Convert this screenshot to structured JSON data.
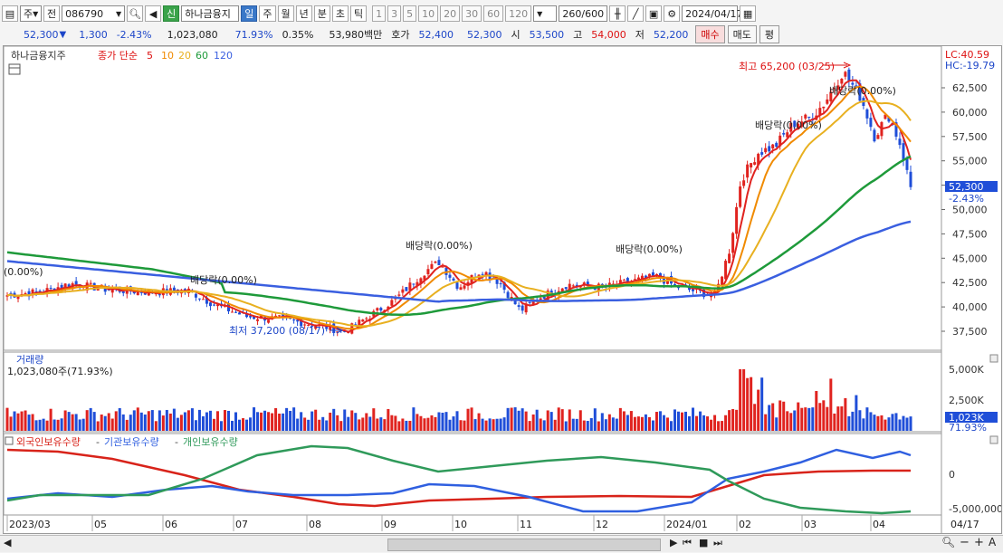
{
  "toolbar": {
    "kind_select": "주",
    "prev_btn": "전",
    "code": "086790",
    "new_badge": "신",
    "stock_name": "하나금융지",
    "periods": [
      "일",
      "주",
      "월",
      "년",
      "분",
      "초",
      "틱"
    ],
    "active_period": "일",
    "intervals": [
      "1",
      "3",
      "5",
      "10",
      "20",
      "30",
      "60",
      "120"
    ],
    "count": "260",
    "count_max": "/600",
    "date": "2024/04/17"
  },
  "quote": {
    "price": "52,300",
    "change": "1,300",
    "change_pct": "-2.43%",
    "volume": "1,023,080",
    "volume_ratio": "71.93%",
    "turnover_pct": "0.35%",
    "amount": "53,980백만",
    "bid_label": "호가",
    "ask": "52,400",
    "bid": "52,300",
    "open_label": "시",
    "open": "53,500",
    "high_label": "고",
    "high": "54,000",
    "low_label": "저",
    "low": "52,200",
    "buy_btn": "매수",
    "sell_btn": "매도",
    "eval_btn": "평"
  },
  "price_panel": {
    "name": "하나금융지주",
    "series_label": "종가 단순",
    "ma": [
      "5",
      "10",
      "20",
      "60",
      "120"
    ],
    "lc": "LC:40.59",
    "hc": "HC:-19.79",
    "high_note": "최고 65,200 (03/25)",
    "low_note": "최저 37,200 (08/17)",
    "dividend_notes": [
      "배당락(0.00%)",
      "배당락(0.00%)",
      "배당락(0.00%)",
      "배당락(0.00%)",
      "배당락(0.00%)",
      "(0.00%)"
    ],
    "yticks": [
      "62,500",
      "60,000",
      "57,500",
      "55,000",
      "52,500",
      "50,000",
      "47,500",
      "45,000",
      "42,500",
      "40,000",
      "37,500"
    ],
    "last_price_tag": "52,300",
    "last_change_tag": "-2.43%"
  },
  "volume_panel": {
    "title": "거래량",
    "info": "1,023,080주(71.93%)",
    "yticks": [
      "5,000K",
      "2,500K"
    ],
    "last_tag": "1,023K",
    "last_pct": "71.93%"
  },
  "holders_panel": {
    "legend": [
      "외국인보유수량",
      "기관보유수량",
      "개인보유수량"
    ],
    "yticks": [
      "0",
      "-5,000,000"
    ]
  },
  "xaxis": [
    "2023/03",
    "05",
    "06",
    "07",
    "08",
    "09",
    "10",
    "11",
    "12",
    "2024/01",
    "02",
    "03",
    "04",
    "04/17"
  ],
  "colors": {
    "up": "#e0231f",
    "down": "#1f4ed8",
    "ma5": "#e0231f",
    "ma10": "#f08a00",
    "ma20": "#e8b020",
    "ma60": "#1e9a3a",
    "ma120": "#3a5fe0",
    "foreign": "#d8231a",
    "institution": "#2f5fe0",
    "individual": "#2f9a5a"
  },
  "chart_data": {
    "type": "candlestick",
    "unit": "KRW",
    "highest": {
      "value": 65200,
      "date": "03/25"
    },
    "lowest": {
      "value": 37200,
      "date": "08/17"
    },
    "close_monthly": [
      {
        "m": "2023/03",
        "close": 41500
      },
      {
        "m": "04",
        "close": 42300
      },
      {
        "m": "05",
        "close": 41800
      },
      {
        "m": "06",
        "close": 41500
      },
      {
        "m": "07",
        "close": 39500
      },
      {
        "m": "08",
        "close": 38000
      },
      {
        "m": "09",
        "close": 44500
      },
      {
        "m": "10",
        "close": 42500
      },
      {
        "m": "11",
        "close": 40800
      },
      {
        "m": "12",
        "close": 42000
      },
      {
        "m": "2024/01",
        "close": 41500
      },
      {
        "m": "02",
        "close": 55500
      },
      {
        "m": "03",
        "close": 62500
      },
      {
        "m": "04",
        "close": 52300
      }
    ],
    "ma120_end": 48600,
    "ma60_end": 55800
  }
}
